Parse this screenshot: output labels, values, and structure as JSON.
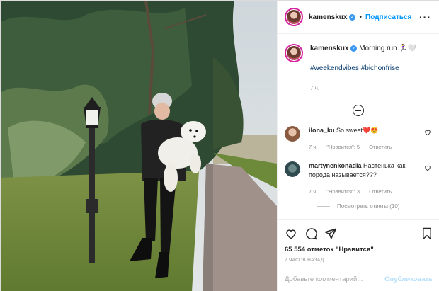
{
  "header": {
    "username": "kamenskux",
    "follow_label": "Подписаться",
    "separator": "•"
  },
  "caption": {
    "username": "kamenskux",
    "text": "Morning run 🏃‍♀️🤍",
    "hashtags": "#weekendvibes #bichonfrise",
    "time": "7 ч."
  },
  "comments": [
    {
      "username": "ilona_ku",
      "text": "So sweet❤️😍",
      "time": "7 ч.",
      "likes": "\"Нравится\": 5",
      "reply_label": "Ответить"
    },
    {
      "username": "martynenkonadia",
      "text": "Настенька как порода называется???",
      "time": "7 ч.",
      "likes": "\"Нравится\": 3",
      "reply_label": "Ответить"
    }
  ],
  "view_replies": "Посмотреть ответы (10)",
  "likes_count": "65 554 отметок \"Нравится\"",
  "time_ago": "7 ЧАСОВ НАЗАД",
  "add_comment": {
    "placeholder": "Добавьте комментарий...",
    "publish_label": "Опубликовать"
  },
  "icons": [
    "heart-icon",
    "comment-icon",
    "share-icon",
    "bookmark-icon",
    "more-icon",
    "add-comment-icon",
    "verified-icon"
  ],
  "colors": {
    "accent": "#0095f6",
    "hashtag": "#00376b",
    "muted": "#8e8e8e",
    "publish_disabled": "#b2dffc"
  }
}
